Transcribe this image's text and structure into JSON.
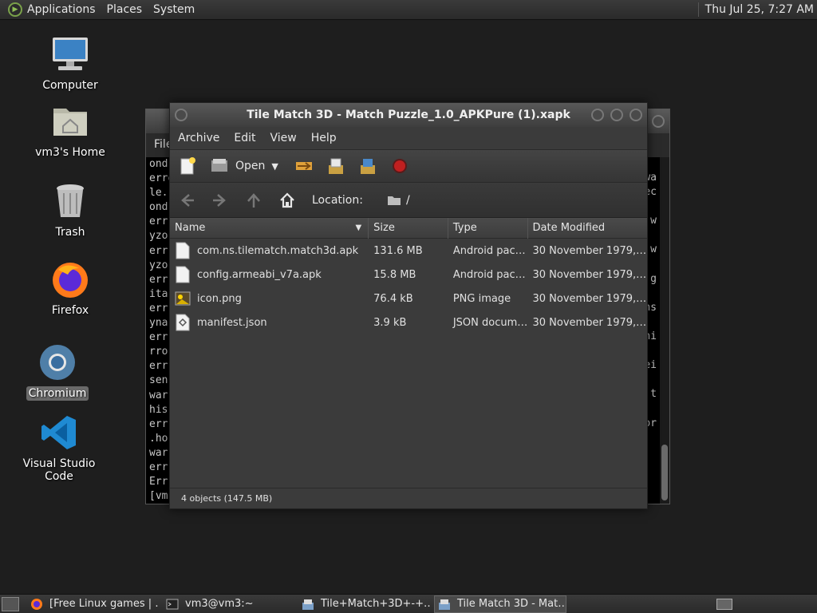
{
  "top_panel": {
    "menus": [
      "Applications",
      "Places",
      "System"
    ],
    "clock": "Thu Jul 25,  7:27 AM"
  },
  "desktop_icons": [
    {
      "label": "Computer",
      "icon": "computer-icon"
    },
    {
      "label": "vm3's Home",
      "icon": "home-folder-icon"
    },
    {
      "label": "Trash",
      "icon": "trash-icon"
    },
    {
      "label": "Firefox",
      "icon": "firefox-icon"
    },
    {
      "label": "Chromium",
      "icon": "chromium-icon",
      "selected": true
    },
    {
      "label": "Visual Studio Code",
      "icon": "vscode-icon"
    }
  ],
  "terminal": {
    "menu_fragment": "File",
    "lines": [
      "ond",
      "erro",
      "le.",
      "ond",
      "err",
      "yzo",
      "err",
      "yzo",
      "err",
      "ita",
      "err",
      "yna",
      "err",
      "rro",
      "err",
      "sen",
      "war",
      "his",
      "err",
      ".ho",
      "war",
      "err",
      "Err",
      "[vm"
    ],
    "right_fragments": [
      "wa",
      "ec",
      "",
      "w",
      "",
      "w",
      "",
      "g",
      "",
      "ns",
      "",
      "ni",
      "",
      "ei",
      "",
      "t",
      "",
      "or"
    ]
  },
  "file_roller": {
    "title": "Tile Match 3D - Match Puzzle_1.0_APKPure (1).xapk",
    "menus": [
      "Archive",
      "Edit",
      "View",
      "Help"
    ],
    "toolbar": {
      "open_label": "Open"
    },
    "location_label": "Location:",
    "location_value": "/",
    "columns": {
      "name": "Name",
      "size": "Size",
      "type": "Type",
      "date": "Date Modified"
    },
    "files": [
      {
        "name": "com.ns.tilematch.match3d.apk",
        "size": "131.6 MB",
        "type": "Android pac…",
        "date": "30 November 1979, …",
        "icon": "file-icon"
      },
      {
        "name": "config.armeabi_v7a.apk",
        "size": "15.8 MB",
        "type": "Android pac…",
        "date": "30 November 1979, …",
        "icon": "file-icon"
      },
      {
        "name": "icon.png",
        "size": "76.4 kB",
        "type": "PNG image",
        "date": "30 November 1979, …",
        "icon": "image-icon"
      },
      {
        "name": "manifest.json",
        "size": "3.9 kB",
        "type": "JSON docum…",
        "date": "30 November 1979, …",
        "icon": "json-icon"
      }
    ],
    "status": "4 objects (147.5 MB)"
  },
  "taskbar": {
    "tasks": [
      {
        "label": "[Free Linux games | …",
        "icon": "firefox-icon"
      },
      {
        "label": "vm3@vm3:~",
        "icon": "terminal-icon"
      },
      {
        "label": "Tile+Match+3D+-+…",
        "icon": "archive-icon"
      },
      {
        "label": "Tile Match 3D - Mat…",
        "icon": "archive-icon",
        "active": true
      }
    ]
  }
}
